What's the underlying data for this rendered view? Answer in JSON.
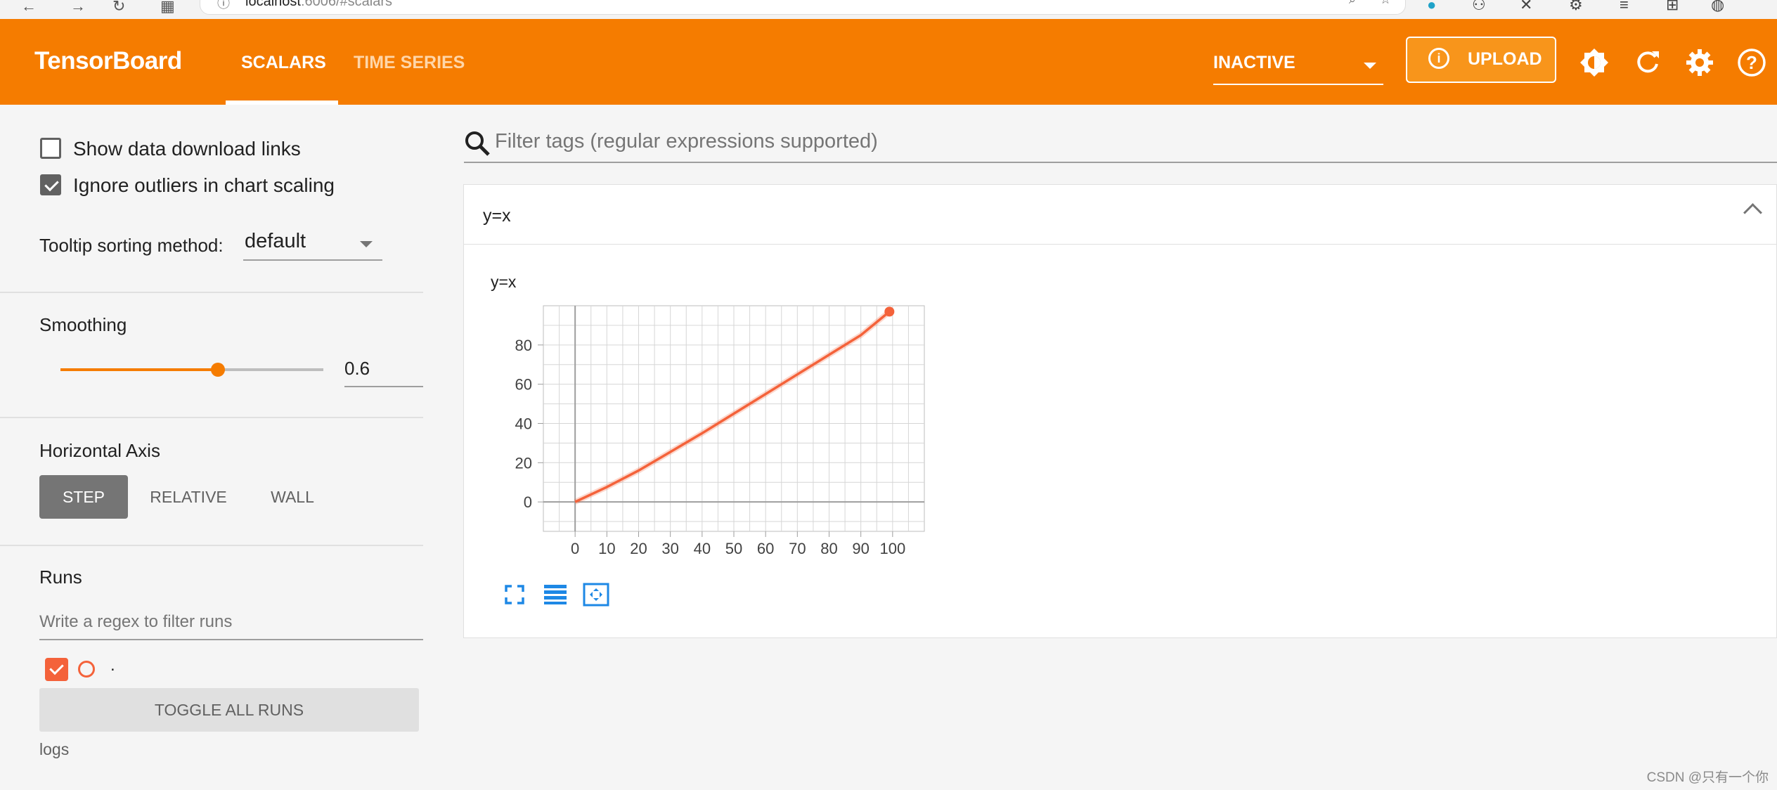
{
  "browser": {
    "url_host": "localhost",
    "url_rest": ":6006/#scalars"
  },
  "header": {
    "brand": "TensorBoard",
    "tabs": [
      {
        "label": "SCALARS",
        "active": true
      },
      {
        "label": "TIME SERIES",
        "active": false
      }
    ],
    "status_select": "INACTIVE",
    "upload_label": "UPLOAD"
  },
  "sidebar": {
    "show_download_links": {
      "label": "Show data download links",
      "checked": false
    },
    "ignore_outliers": {
      "label": "Ignore outliers in chart scaling",
      "checked": true
    },
    "tooltip_sorting": {
      "label": "Tooltip sorting method:",
      "value": "default"
    },
    "smoothing": {
      "label": "Smoothing",
      "value": "0.6"
    },
    "horizontal_axis": {
      "label": "Horizontal Axis",
      "options": [
        "STEP",
        "RELATIVE",
        "WALL"
      ],
      "selected": "STEP"
    },
    "runs": {
      "label": "Runs",
      "filter_placeholder": "Write a regex to filter runs",
      "items": [
        {
          "name": ".",
          "checked": true,
          "color": "#f4623a"
        }
      ],
      "toggle_label": "TOGGLE ALL RUNS",
      "logdir": "logs"
    }
  },
  "main": {
    "filter_placeholder": "Filter tags (regular expressions supported)",
    "card": {
      "title": "y=x",
      "chart_title": "y=x"
    }
  },
  "chart_data": {
    "type": "line",
    "title": "y=x",
    "xlabel": "",
    "ylabel": "",
    "x_ticks": [
      0,
      10,
      20,
      30,
      40,
      50,
      60,
      70,
      80,
      90,
      100
    ],
    "y_ticks": [
      0,
      20,
      40,
      60,
      80
    ],
    "xlim": [
      -10,
      110
    ],
    "ylim": [
      -15,
      100
    ],
    "grid": true,
    "series": [
      {
        "values_x": [
          0,
          10,
          20,
          30,
          40,
          50,
          60,
          70,
          80,
          90,
          99
        ],
        "values_y": [
          0,
          7.6,
          16,
          25.5,
          35,
          45,
          55,
          65,
          75,
          85,
          97
        ],
        "color": "#f4623a"
      }
    ]
  },
  "watermark": "CSDN @只有一个你"
}
